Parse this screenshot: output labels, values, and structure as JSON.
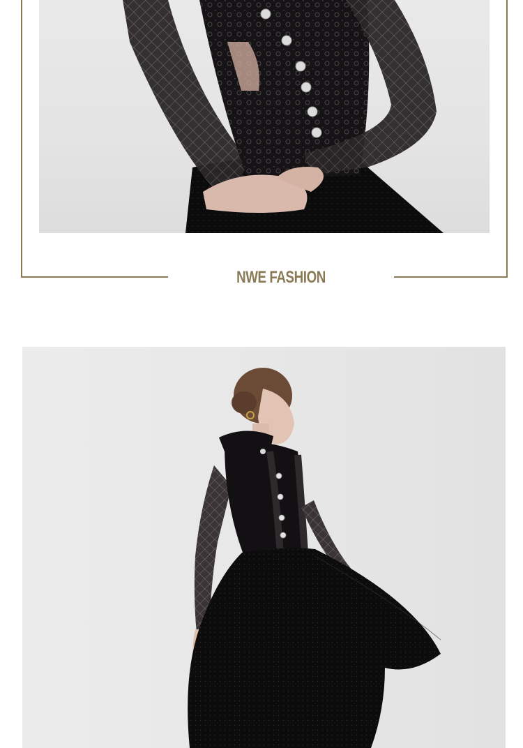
{
  "brand": {
    "label": "NWE FASHION",
    "color": "#8a7a55"
  },
  "images": {
    "top": {
      "icon": "dress-detail-photo"
    },
    "bottom": {
      "icon": "model-dress-photo"
    }
  },
  "colors": {
    "frame": "#8a7a55",
    "background": "#ffffff",
    "photo_bg": "#e6e6e6"
  }
}
